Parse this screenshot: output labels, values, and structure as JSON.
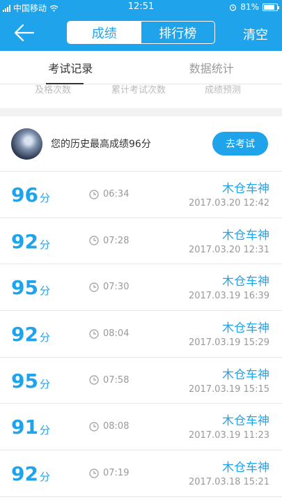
{
  "status_bar": {
    "carrier": "中国移动",
    "time": "12:51",
    "battery": "81%"
  },
  "header": {
    "segments": [
      "成绩",
      "排行榜"
    ],
    "clear_label": "清空"
  },
  "tabs": [
    "考试记录",
    "数据统计"
  ],
  "sub_labels": [
    "及格次数",
    "累计考试次数",
    "成绩预测"
  ],
  "best": {
    "text": "您的历史最高成绩96分",
    "button": "去考试"
  },
  "score_unit": "分",
  "records": [
    {
      "score": "96",
      "duration": "06:34",
      "name": "木仓车神",
      "date": "2017.03.20  12:42"
    },
    {
      "score": "92",
      "duration": "07:28",
      "name": "木仓车神",
      "date": "2017.03.20  12:31"
    },
    {
      "score": "95",
      "duration": "07:30",
      "name": "木仓车神",
      "date": "2017.03.19  16:39"
    },
    {
      "score": "92",
      "duration": "08:04",
      "name": "木仓车神",
      "date": "2017.03.19  15:29"
    },
    {
      "score": "95",
      "duration": "07:58",
      "name": "木仓车神",
      "date": "2017.03.19  15:15"
    },
    {
      "score": "91",
      "duration": "08:08",
      "name": "木仓车神",
      "date": "2017.03.19  11:23"
    },
    {
      "score": "92",
      "duration": "07:19",
      "name": "木仓车神",
      "date": "2017.03.18  15:21"
    }
  ]
}
